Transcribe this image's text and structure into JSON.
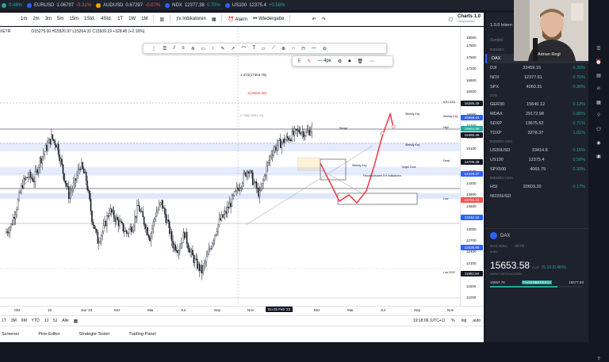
{
  "ticker": [
    {
      "sym": "",
      "val": "",
      "chg": "0.48%",
      "dir": "up",
      "dot": "#26a69a"
    },
    {
      "sym": "EURUSD",
      "val": "1.06797",
      "chg": "-0.31%",
      "dir": "dn",
      "dot": "#2962ff"
    },
    {
      "sym": "AUDUSD",
      "val": "0.67297",
      "chg": "-0.07%",
      "dir": "dn",
      "dot": "#f7a600"
    },
    {
      "sym": "NDX",
      "val": "12377.38",
      "chg": "0.70%",
      "dir": "up",
      "dot": "#2962ff"
    },
    {
      "sym": "US100",
      "val": "12375.4",
      "chg": "+0.58%",
      "dir": "up",
      "dot": "#2962ff"
    }
  ],
  "toolbar": {
    "intervals": [
      "1m",
      "2m",
      "3m",
      "5m",
      "15m",
      "1Std.",
      "4Std.",
      "1T",
      "1W",
      "1M"
    ],
    "indicators_label": "Indikatoren",
    "alarm_label": "Alarm",
    "replay_label": "Wiedergabe",
    "layout_label": "Charts 1.0",
    "layout_sub": "Gespeichert"
  },
  "legend": {
    "symbol": "XETR",
    "ohlc": "O15275.00 H15520.97 L15264.31 C15509.19 +328.45 (+2.16%)"
  },
  "chart_data": {
    "type": "candlestick",
    "symbol": "DAX",
    "yticks": [
      18000,
      17800,
      17500,
      17200,
      16900,
      16600,
      16300,
      16000,
      15700,
      15400,
      15100,
      14800,
      14500,
      14200,
      13900,
      13600,
      13300,
      13000,
      12700,
      12400,
      12100,
      11800,
      11500,
      11200
    ],
    "yrange": [
      11000,
      18300
    ],
    "xticks": [
      "Okt",
      "16",
      "Jan '23",
      "Mrz",
      "Mai",
      "Jul",
      "Sep",
      "Nov",
      "2023",
      "Mrz",
      "Mai",
      "Jul",
      "Sep",
      "Nov"
    ],
    "cursor_label": "Do 02 Feb '23",
    "price_tags": [
      {
        "label": "ATH 2021",
        "price": "16285.35",
        "color": "#131722"
      },
      {
        "label": "Weekly Key",
        "price": "15958.41",
        "color": "#2962ff"
      },
      {
        "label": "High",
        "price": "15653.58",
        "color": "#26a69a"
      },
      {
        "label": "",
        "price": "15493.46",
        "color": "#131722"
      },
      {
        "label": "Dead",
        "price": "14709.38",
        "color": "#131722"
      },
      {
        "label": "",
        "price": "14438.37",
        "color": "#2962ff"
      },
      {
        "label": "Low",
        "price": "13791.33",
        "color": "#ef5350"
      },
      {
        "label": "",
        "price": "13342.44",
        "color": "#2962ff"
      },
      {
        "label": "",
        "price": "12535.90",
        "color": "#2962ff"
      },
      {
        "label": "Low 2022",
        "price": "11862.84",
        "color": "#131722"
      }
    ],
    "fib_labels": [
      "1.272(17304.79)",
      "1(16600.38)",
      "0.786(15994.20)",
      "0.5"
    ],
    "annotations": [
      "Range",
      "Weekly Key",
      "Weekly Key",
      "Target Zone",
      "Weekly Key",
      "Fibonaccisuche Erf Indikatoren"
    ],
    "series": [
      {
        "name": "DAX",
        "values": [
          12900,
          13100,
          13600,
          14200,
          14400,
          14300,
          14800,
          15100,
          15400,
          15200,
          14500,
          13900,
          14200,
          14700,
          14300,
          13300,
          12700,
          13000,
          13500,
          13300,
          13100,
          12900,
          13100,
          13600,
          13200,
          12800,
          13400,
          13700,
          13200,
          12600,
          12500,
          12900,
          12400,
          12100,
          11900,
          12300,
          12800,
          13200,
          13400,
          13700,
          14000,
          14300,
          14600,
          14200,
          13900,
          14500,
          15000,
          15200,
          15300,
          15400,
          15500,
          15600,
          15500,
          15650
        ]
      }
    ]
  },
  "xaxis_right": {
    "time": "19:18:06 (UTC+1)",
    "pct": "%",
    "log": "log",
    "auto": "auto"
  },
  "ranges": [
    "1T",
    "3M",
    "6M",
    "YTD",
    "1J",
    "5J",
    "Alle"
  ],
  "bottom_tabs": [
    "Screener",
    "Pine-Editor",
    "Strategie-Tester",
    "Trading-Panel"
  ],
  "drawbar": {
    "width_label": "4px"
  },
  "watchlist": {
    "title": "1.0.0 Intern",
    "user": "Adrian Rogl",
    "header": [
      "Symbol",
      "",
      ""
    ],
    "sections": [
      {
        "name": "INDIZES",
        "rows": [
          {
            "sym": "DAX",
            "last": "15653.58",
            "chg": "0.48%",
            "dir": "up",
            "active": true
          },
          {
            "sym": "DJI",
            "last": "33459.15",
            "chg": "0.20%",
            "dir": "up"
          },
          {
            "sym": "NDX",
            "last": "12377.61",
            "chg": "0.70%",
            "dir": "up"
          },
          {
            "sym": "SPX",
            "last": "4060.31",
            "chg": "0.36%",
            "dir": "up"
          }
        ]
      },
      {
        "name": "CFD",
        "rows": [
          {
            "sym": "GER30",
            "last": "15646.12",
            "chg": "0.13%",
            "dir": "up"
          },
          {
            "sym": "MDAX",
            "last": "29172.98",
            "chg": "0.88%",
            "dir": "up"
          },
          {
            "sym": "SDXP",
            "last": "13675.52",
            "chg": "0.71%",
            "dir": "up"
          },
          {
            "sym": "TDXP",
            "last": "3278.37",
            "chg": "1.01%",
            "dir": "up"
          }
        ]
      },
      {
        "name": "INDIZES USA",
        "rows": [
          {
            "sym": "US30USD",
            "last": "33414.8",
            "chg": "0.16%",
            "dir": "up"
          },
          {
            "sym": "US100",
            "last": "12375.4",
            "chg": "0.58%",
            "dir": "up"
          },
          {
            "sym": "SPX500",
            "last": "4065.79",
            "chg": "0.33%",
            "dir": "up"
          }
        ]
      },
      {
        "name": "INDIZES ASIA",
        "rows": [
          {
            "sym": "HSI",
            "last": "20603.20",
            "chg": "0.17%",
            "dir": "up"
          },
          {
            "sym": "NI225USD",
            "last": "",
            "chg": "",
            "dir": "up"
          }
        ]
      }
    ],
    "detail": {
      "symbol": "DAX",
      "name": "DAX Index",
      "exchange": "XETR",
      "type": "Index",
      "price": "15653.58",
      "currency": "EUR",
      "change": "75.19 (0.48%)",
      "status": "MARKT GESCHLOSSEN",
      "range_low": "15587.78",
      "range_label": "TAGESBEREICH",
      "range_high": "15677.93"
    }
  }
}
